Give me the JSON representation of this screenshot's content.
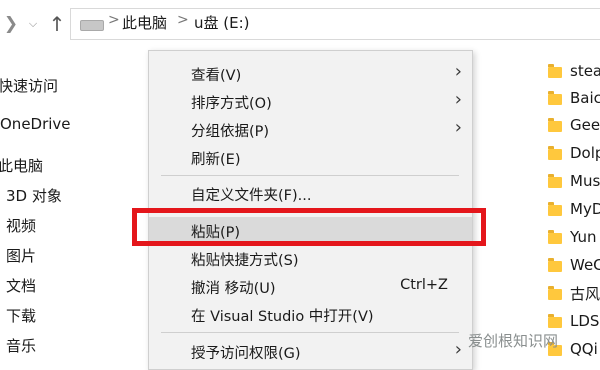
{
  "address": {
    "back_icon": "chevron-left-icon",
    "forward_icon": "chevron-right-icon",
    "dropdown_icon": "chevron-down-icon",
    "up_icon": "arrow-up-icon",
    "crumbs": [
      "此电脑",
      "u盘 (E:)"
    ],
    "separator": ">"
  },
  "nav": [
    "快速访问",
    "OneDrive",
    "此电脑",
    "3D 对象",
    "视频",
    "图片",
    "文档",
    "下载",
    "音乐"
  ],
  "files": [
    "stea",
    "Baic",
    "Gee",
    "Dolp",
    "Mus",
    "MyD",
    "Yun",
    "WeC",
    "古风",
    "LDS",
    "QQi"
  ],
  "menu": {
    "view": {
      "label": "查看(V)"
    },
    "sort": {
      "label": "排序方式(O)"
    },
    "group": {
      "label": "分组依据(P)"
    },
    "refresh": {
      "label": "刷新(E)"
    },
    "customize": {
      "label": "自定义文件夹(F)..."
    },
    "paste": {
      "label": "粘贴(P)"
    },
    "paste_shortcut": {
      "label": "粘贴快捷方式(S)"
    },
    "undo": {
      "label": "撤消 移动(U)",
      "shortcut": "Ctrl+Z"
    },
    "open_vs": {
      "label": "在 Visual Studio 中打开(V)"
    },
    "grant": {
      "label": "授予访问权限(G)"
    }
  },
  "colors": {
    "highlight_box": "#e4161b",
    "menu_bg": "#f2f2f2",
    "folder": "#ffc83d"
  },
  "watermark": "爱创根知识网"
}
